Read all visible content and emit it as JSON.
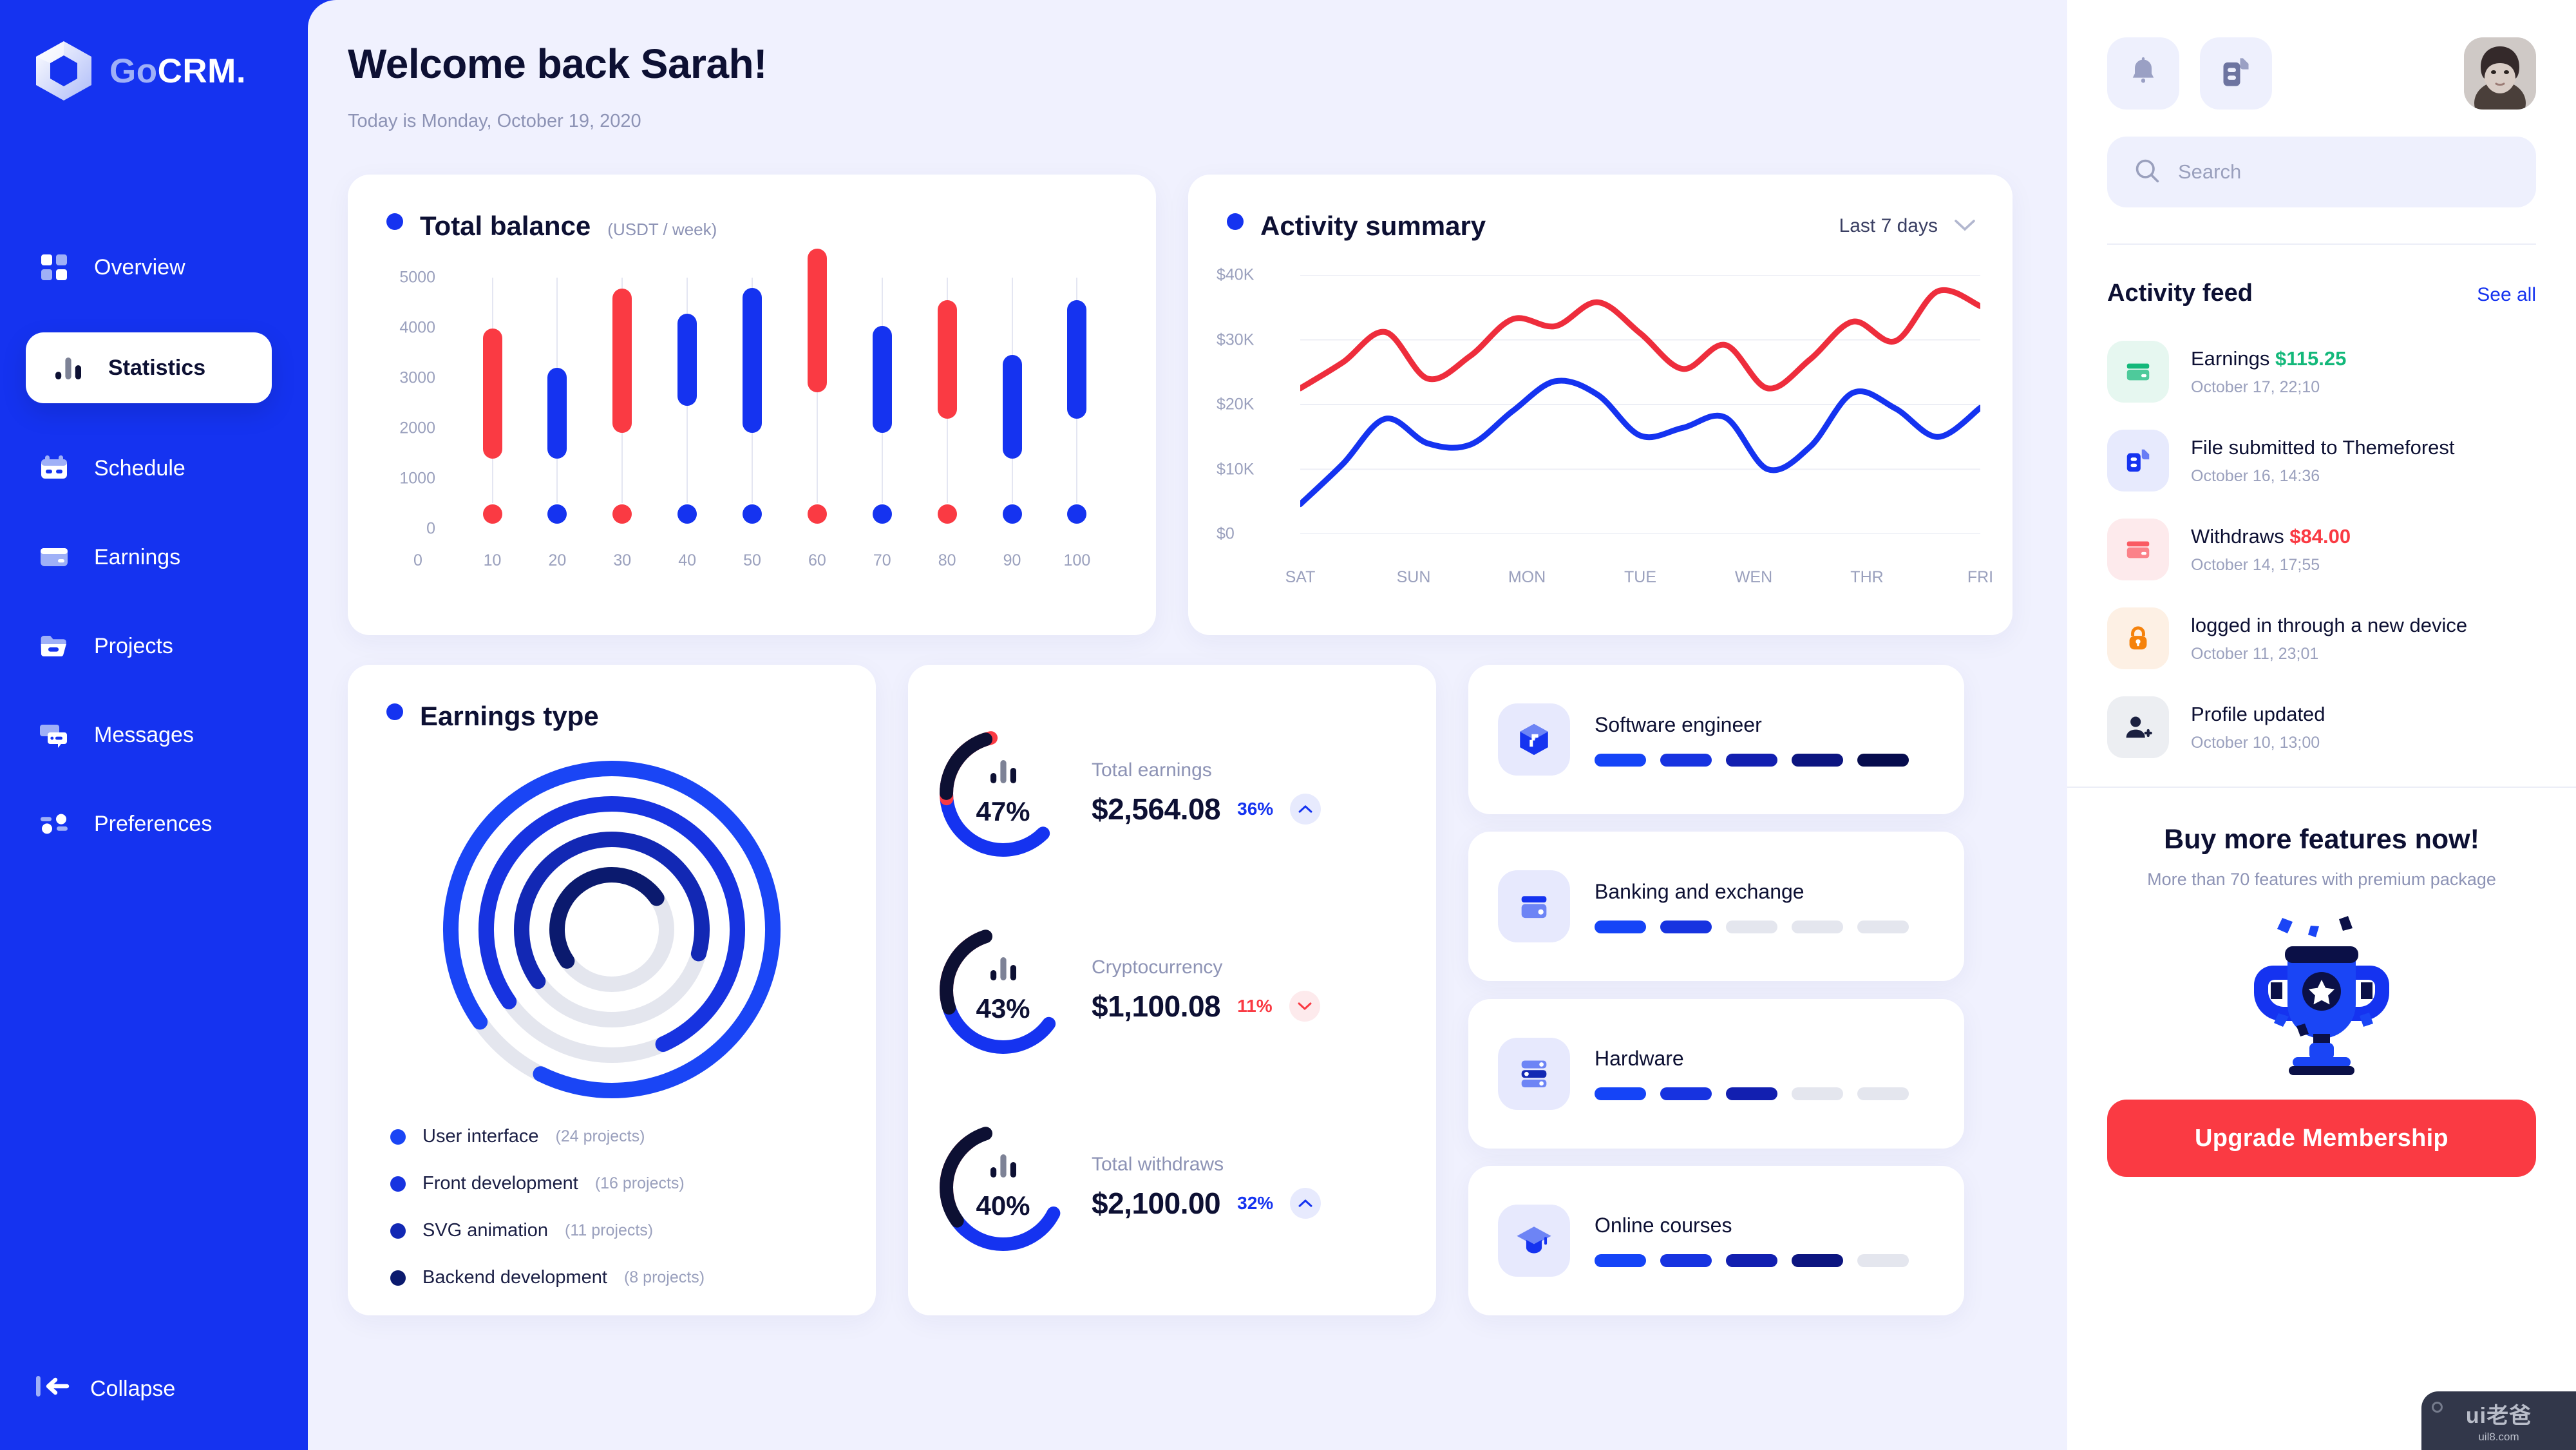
{
  "brand": {
    "go": "Go",
    "crm": "CRM",
    "dot": "."
  },
  "sidebar": {
    "items": [
      {
        "label": "Overview",
        "icon": "grid-icon",
        "active": false
      },
      {
        "label": "Statistics",
        "icon": "bar-chart-icon",
        "active": true
      },
      {
        "label": "Schedule",
        "icon": "calendar-icon",
        "active": false
      },
      {
        "label": "Earnings",
        "icon": "credit-card-icon",
        "active": false
      },
      {
        "label": "Projects",
        "icon": "folder-icon",
        "active": false
      },
      {
        "label": "Messages",
        "icon": "chat-icon",
        "active": false
      },
      {
        "label": "Preferences",
        "icon": "sliders-icon",
        "active": false
      }
    ],
    "collapse_label": "Collapse"
  },
  "header": {
    "title": "Welcome back Sarah!",
    "subtitle": "Today is Monday, October 19, 2020"
  },
  "topbar": {
    "notification_icon": "bell-icon",
    "files_icon": "copy-files-icon",
    "avatar": "user-avatar",
    "search": {
      "placeholder": "Search",
      "value": "",
      "icon": "search-icon"
    }
  },
  "balance_card": {
    "title": "Total balance",
    "subtitle": "(USDT / week)"
  },
  "activity_card": {
    "title": "Activity summary",
    "range_label": "Last 7 days",
    "chevron": "chevron-down-icon"
  },
  "earnings_type_card": {
    "title": "Earnings type",
    "legend": [
      {
        "label": "User interface",
        "count": "(24 projects)",
        "color": "#1a45f5",
        "pct": 92
      },
      {
        "label": "Front development",
        "count": "(16 projects)",
        "color": "#1733e0",
        "pct": 78
      },
      {
        "label": "SVG animation",
        "count": "(11 projects)",
        "color": "#1228b4",
        "pct": 64
      },
      {
        "label": "Backend development",
        "count": "(8 projects)",
        "color": "#0b1a6e",
        "pct": 50
      }
    ]
  },
  "stats": [
    {
      "name": "Total earnings",
      "percent": "47%",
      "value": "$2,564.08",
      "delta": "36%",
      "direction": "up",
      "delta_color": "#1533f0",
      "arcs": {
        "blue": 47,
        "red": 28,
        "dark": 25
      }
    },
    {
      "name": "Cryptocurrency",
      "percent": "43%",
      "value": "$1,100.08",
      "delta": "11%",
      "direction": "down",
      "delta_color": "#fa3a43",
      "arcs": {
        "blue": 43,
        "red": 27,
        "dark": 30
      }
    },
    {
      "name": "Total withdraws",
      "percent": "40%",
      "value": "$2,100.00",
      "delta": "32%",
      "direction": "up",
      "delta_color": "#1533f0",
      "arcs": {
        "blue": 40,
        "red": 25,
        "dark": 35
      }
    }
  ],
  "skills": [
    {
      "name": "Software engineer",
      "icon": "cube-icon",
      "filled": 5,
      "total": 5
    },
    {
      "name": "Banking and exchange",
      "icon": "wallet-icon",
      "filled": 2,
      "total": 5
    },
    {
      "name": "Hardware",
      "icon": "server-icon",
      "filled": 3,
      "total": 5
    },
    {
      "name": "Online courses",
      "icon": "graduation-icon",
      "filled": 4,
      "total": 5
    }
  ],
  "feed": {
    "title": "Activity feed",
    "see_all": "See all",
    "items": [
      {
        "text": "Earnings ",
        "amount": "$115.25",
        "amount_color": "#13b87a",
        "time": "October 17, 22;10",
        "icon": "credit-card-icon",
        "bg": "#e6f7f0",
        "fg": "#13b87a"
      },
      {
        "text": "File submitted to Themeforest",
        "amount": "",
        "amount_color": "",
        "time": "October 16, 14:36",
        "icon": "copy-files-icon",
        "bg": "#e7eafd",
        "fg": "#1533f0"
      },
      {
        "text": "Withdraws ",
        "amount": "$84.00",
        "amount_color": "#fa3a43",
        "time": "October 14, 17;55",
        "icon": "credit-card-icon",
        "bg": "#fdeaec",
        "fg": "#fa5a62"
      },
      {
        "text": "logged in through a new device",
        "amount": "",
        "amount_color": "",
        "time": "October 11, 23;01",
        "icon": "lock-icon",
        "bg": "#fdf0e4",
        "fg": "#f5820b"
      },
      {
        "text": "Profile updated",
        "amount": "",
        "amount_color": "",
        "time": "October 10, 13;00",
        "icon": "add-user-icon",
        "bg": "#eceef2",
        "fg": "#1b2040"
      }
    ]
  },
  "promo": {
    "title": "Buy more features now!",
    "subtitle": "More than 70 features with premium package",
    "button": "Upgrade Membership",
    "art": "trophy-icon"
  },
  "watermark": {
    "top": "ui老爸",
    "bottom": "uil8.com"
  },
  "colors": {
    "brand_blue": "#1533f0",
    "red": "#fa3a43",
    "dark_navy": "#0d1033",
    "bg": "#f0f1fe",
    "muted": "#9aa0bd"
  },
  "chart_data": [
    {
      "type": "bar",
      "title": "Total balance",
      "subtitle": "(USDT / week)",
      "xlabel": "",
      "ylabel": "",
      "xlim": [
        0,
        105
      ],
      "ylim": [
        0,
        5000
      ],
      "yticks": [
        0,
        1000,
        2000,
        3000,
        4000,
        5000
      ],
      "xticks": [
        0,
        10,
        20,
        30,
        40,
        50,
        60,
        70,
        80,
        90,
        100
      ],
      "grid": false,
      "note": "floating range bars (low-high) with a dot marker at zero",
      "categories": [
        10,
        20,
        30,
        40,
        50,
        60,
        70,
        80,
        90,
        100
      ],
      "series": [
        {
          "name": "low",
          "values": [
            880,
            890,
            1400,
            1930,
            1400,
            2200,
            1400,
            1680,
            880,
            1680
          ]
        },
        {
          "name": "high",
          "values": [
            3480,
            2690,
            4270,
            3770,
            4280,
            5060,
            3520,
            4040,
            2950,
            4040
          ]
        }
      ],
      "bar_colors": [
        "#fa3a43",
        "#1533f0",
        "#fa3a43",
        "#1533f0",
        "#1533f0",
        "#fa3a43",
        "#1533f0",
        "#fa3a43",
        "#1533f0",
        "#1533f0"
      ]
    },
    {
      "type": "line",
      "title": "Activity summary",
      "xlabel": "",
      "ylabel": "",
      "ylim": [
        0,
        40000
      ],
      "yticks": [
        0,
        10000,
        20000,
        30000,
        40000
      ],
      "ytick_labels": [
        "$0",
        "$10K",
        "$20K",
        "$30K",
        "$40K"
      ],
      "categories": [
        "SAT",
        "SUN",
        "MON",
        "TUE",
        "WEN",
        "THR",
        "FRI"
      ],
      "grid": true,
      "legend": "none",
      "series": [
        {
          "name": "red",
          "color": "#ee2d3c",
          "values": [
            22500,
            26500,
            31200,
            24000,
            27500,
            33200,
            32100,
            35800,
            31000,
            25500,
            29200,
            22500,
            27000,
            32800,
            29800,
            37500,
            35200
          ]
        },
        {
          "name": "blue",
          "color": "#1533f0",
          "values": [
            4600,
            10800,
            17800,
            14000,
            13800,
            19000,
            23600,
            21500,
            15200,
            16400,
            18000,
            10000,
            13500,
            21800,
            19400,
            15000,
            19500
          ]
        }
      ]
    },
    {
      "type": "pie",
      "title": "Earnings type",
      "note": "four concentric partial rings",
      "labels": [
        "User interface",
        "Front development",
        "SVG animation",
        "Backend development"
      ],
      "values": [
        24,
        16,
        11,
        8
      ],
      "value_unit": "projects",
      "ring_fill_pct": [
        92,
        78,
        64,
        50
      ],
      "colors": [
        "#1a45f5",
        "#1733e0",
        "#1228b4",
        "#0b1a6e"
      ],
      "track_color": "#e4e6ee"
    }
  ]
}
